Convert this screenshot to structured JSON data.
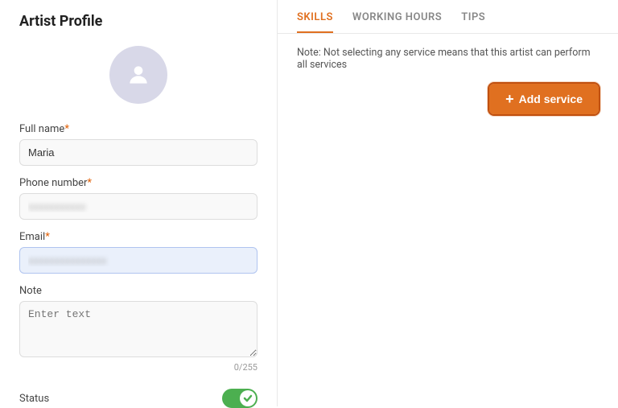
{
  "page": {
    "title": "Artist Profile"
  },
  "left": {
    "avatar_icon": "person-icon",
    "fields": [
      {
        "id": "full-name",
        "label": "Full name",
        "required": true,
        "type": "text",
        "value": "Maria",
        "placeholder": "",
        "focused": false,
        "blurred": false
      },
      {
        "id": "phone-number",
        "label": "Phone number",
        "required": true,
        "type": "text",
        "value": "xxxxxxxxxxx",
        "placeholder": "",
        "focused": false,
        "blurred": true
      },
      {
        "id": "email",
        "label": "Email",
        "required": true,
        "type": "text",
        "value": "xxxxxxxxxxxxxxx",
        "placeholder": "",
        "focused": true,
        "blurred": true
      },
      {
        "id": "note",
        "label": "Note",
        "required": false,
        "type": "textarea",
        "value": "",
        "placeholder": "Enter text",
        "focused": false,
        "blurred": false
      }
    ],
    "char_count": "0/255",
    "status": {
      "label": "Status",
      "enabled": true
    }
  },
  "right": {
    "tabs": [
      {
        "id": "skills",
        "label": "SKILLS",
        "active": true
      },
      {
        "id": "working-hours",
        "label": "WORKING HOURS",
        "active": false
      },
      {
        "id": "tips",
        "label": "TIPS",
        "active": false
      }
    ],
    "note": "Note: Not selecting any service means that this artist can perform all services",
    "add_service_label": "+ Add service"
  }
}
